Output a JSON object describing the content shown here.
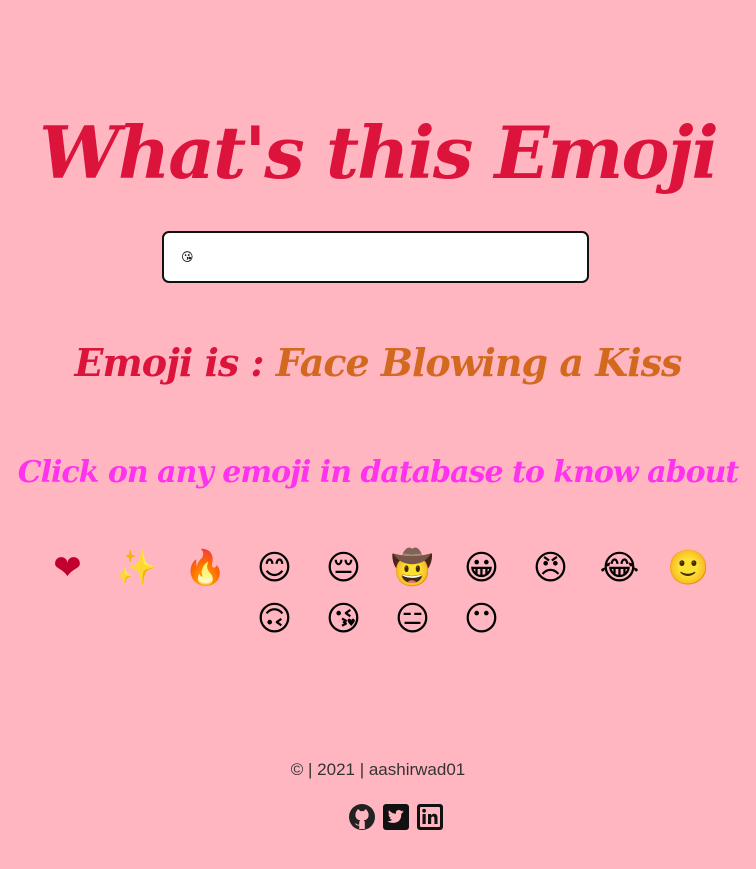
{
  "header": {
    "title": "What's this Emoji"
  },
  "search": {
    "value": "😘",
    "placeholder": ""
  },
  "result": {
    "label": "Emoji is : ",
    "value": "Face Blowing a Kiss"
  },
  "hint": {
    "text": "Click on any emoji in database to know about"
  },
  "emojis": [
    "❤",
    "✨",
    "🔥",
    "😊",
    "😔",
    "🤠",
    "😀",
    "😠",
    "😂",
    "🙂",
    "🙃",
    "😘",
    "😑",
    "😶"
  ],
  "footer": {
    "text": "© | 2021 | aashirwad01"
  },
  "socials": [
    {
      "icon": "github-icon"
    },
    {
      "icon": "twitter-icon"
    },
    {
      "icon": "linkedin-icon"
    }
  ],
  "colors": {
    "background": "#ffb6c1",
    "title": "#dc143c",
    "result_value": "#d2691e",
    "hint": "#ff33ee"
  }
}
